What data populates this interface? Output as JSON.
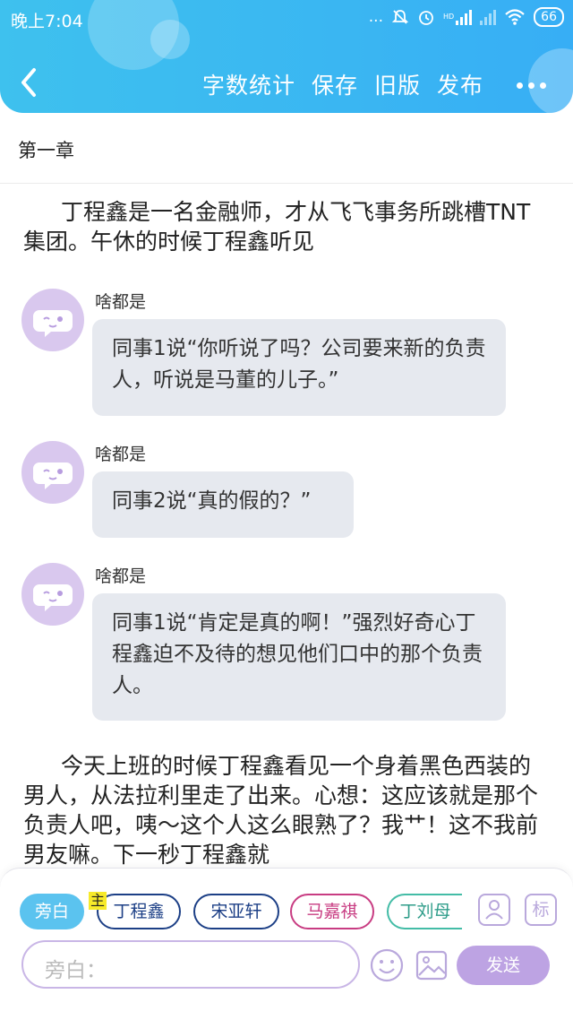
{
  "status_bar": {
    "time": "晚上7:04",
    "dots": "...",
    "battery": "66",
    "hd": "HD"
  },
  "header": {
    "actions": [
      "字数统计",
      "保存",
      "旧版",
      "发布"
    ],
    "colors": {
      "gradient_start": "#3ec1ee",
      "gradient_end": "#37aef5"
    }
  },
  "chapter_title": "第一章",
  "narration_1": "丁程鑫是一名金融师，才从飞飞事务所跳槽TNT集团。午休的时候丁程鑫听见",
  "messages": [
    {
      "name": "啥都是",
      "text": "同事1说“你听说了吗？公司要来新的负责人，听说是马董的儿子。”"
    },
    {
      "name": "啥都是",
      "text": "同事2说“真的假的？”"
    },
    {
      "name": "啥都是",
      "text": "同事1说“肯定是真的啊！”强烈好奇心丁程鑫迫不及待的想见他们口中的那个负责人。"
    }
  ],
  "narration_2": "今天上班的时候丁程鑫看见一个身着黑色西装的男人，从法拉利里走了出来。心想：这应该就是那个负责人吧，咦～这个人这么眼熟了？我艹！这不我前男友嘛。下一秒丁程鑫就",
  "composer": {
    "narrator_chip": "旁白",
    "main_tag": "主",
    "characters": [
      "丁程鑫",
      "宋亚轩",
      "马嘉祺",
      "丁刘母"
    ],
    "tag_icon_label": "标",
    "input_placeholder": "旁白：",
    "send_label": "发送",
    "colors": {
      "accent": "#bda3e3",
      "narrator": "#5bc3ef",
      "navy": "#1c3f86",
      "pink": "#c83c82",
      "teal": "#43bca6"
    }
  }
}
